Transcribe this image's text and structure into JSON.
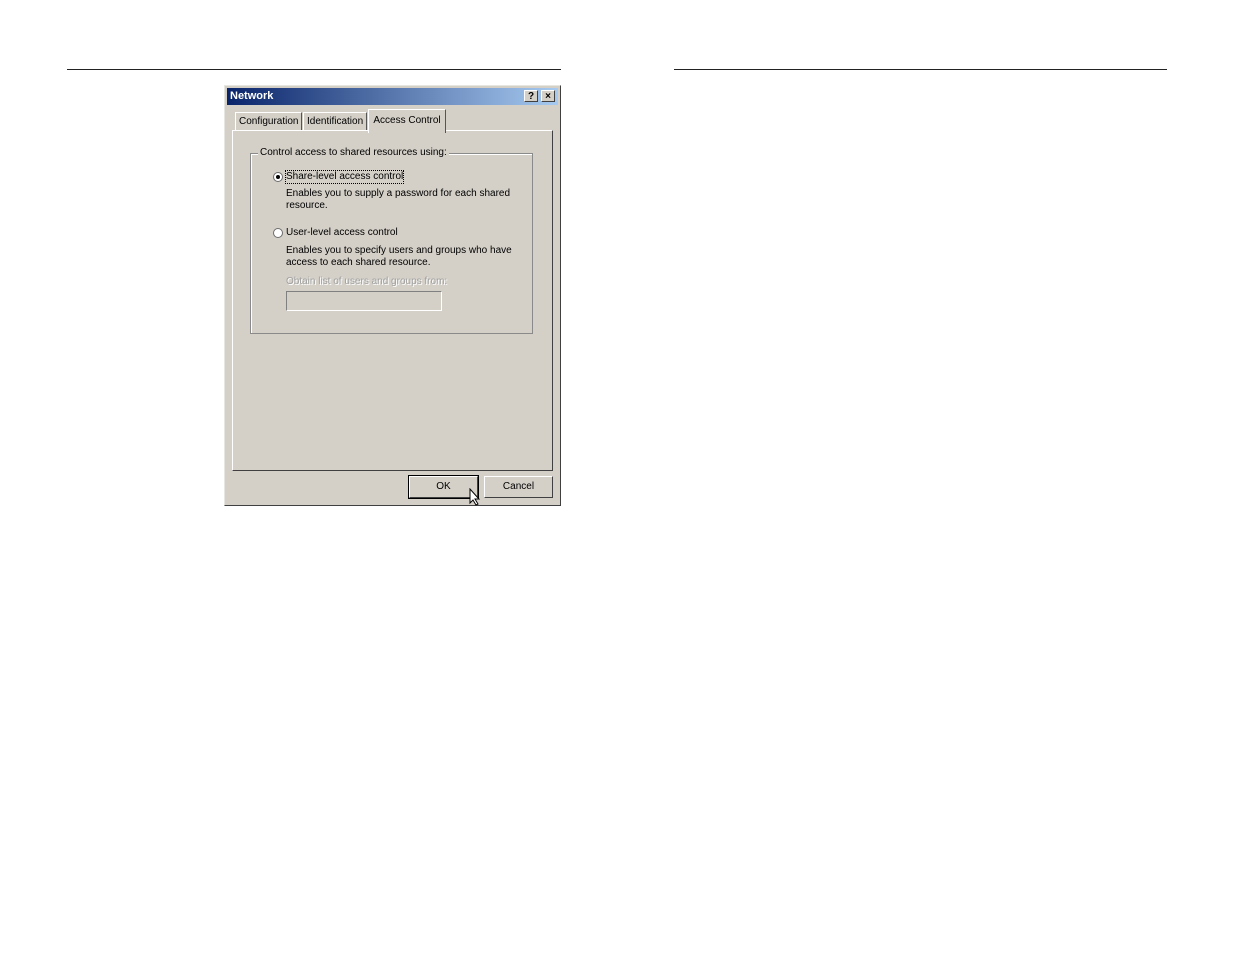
{
  "window": {
    "title": "Network",
    "help_button": "?",
    "close_button": "×"
  },
  "tabs": [
    {
      "label": "Configuration",
      "active": false
    },
    {
      "label": "Identification",
      "active": false
    },
    {
      "label": "Access Control",
      "active": true
    }
  ],
  "access_control": {
    "group_label": "Control access to shared resources using:",
    "share_level": {
      "label": "Share-level access control",
      "description": "Enables you to supply a password for each shared resource.",
      "selected": true
    },
    "user_level": {
      "label": "User-level access control",
      "description": "Enables you to specify users and groups who have access to each shared resource.",
      "selected": false
    },
    "obtain_list_label": "Obtain list of users and groups from:",
    "obtain_list_value": ""
  },
  "buttons": {
    "ok": "OK",
    "cancel": "Cancel"
  }
}
